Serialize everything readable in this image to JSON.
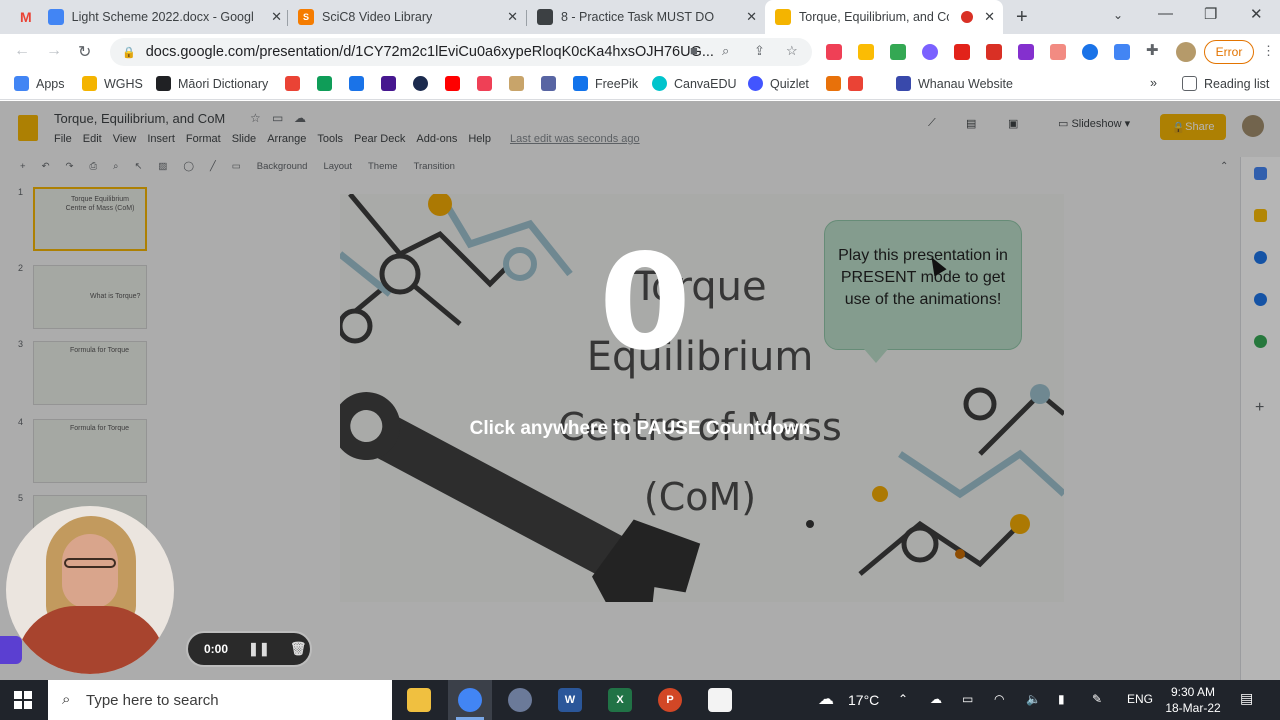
{
  "browser": {
    "tabs": [
      {
        "title": "Light Scheme 2022.docx - Googl",
        "icon": "google-docs-icon",
        "color": "#4285f4"
      },
      {
        "title": "SciC8 Video Library",
        "icon": "video-library-icon",
        "color": "#f57c00"
      },
      {
        "title": "8 - Practice Task MUST DO",
        "icon": "classroom-icon",
        "color": "#3c4043"
      },
      {
        "title": "Torque, Equilibrium, and CoM",
        "icon": "google-slides-icon",
        "color": "#f4b400"
      }
    ],
    "url": "docs.google.com/presentation/d/1CY72m2c1lEviCu0a6xypeRloqK0cKa4hxsOJH76UG...",
    "error_label": "Error",
    "bookmarks": [
      {
        "label": "Apps",
        "color": "#4285f4"
      },
      {
        "label": "WGHS",
        "color": "#f4b400"
      },
      {
        "label": "Māori Dictionary",
        "color": "#202124"
      },
      {
        "label": "",
        "color": "#ea4335"
      },
      {
        "label": "",
        "color": "#0f9d58"
      },
      {
        "label": "",
        "color": "#1a73e8"
      },
      {
        "label": "",
        "color": "#46178f"
      },
      {
        "label": "",
        "color": "#1b2a4e"
      },
      {
        "label": "",
        "color": "#ff0000"
      },
      {
        "label": "",
        "color": "#ef4056"
      },
      {
        "label": "",
        "color": "#c8a46a"
      },
      {
        "label": "",
        "color": "#5865a3"
      },
      {
        "label": "FreePik",
        "color": "#1273eb"
      },
      {
        "label": "CanvaEDU",
        "color": "#00c4cc"
      },
      {
        "label": "Quizlet",
        "color": "#4255ff"
      },
      {
        "label": "",
        "color": "#e8710a"
      },
      {
        "label": "Whanau Website",
        "color": "#3949ab"
      }
    ],
    "reading_list": "Reading list"
  },
  "slides": {
    "doc_title": "Torque, Equilibrium, and CoM",
    "menu": [
      "File",
      "Edit",
      "View",
      "Insert",
      "Format",
      "Slide",
      "Arrange",
      "Tools",
      "Pear Deck",
      "Add-ons",
      "Help"
    ],
    "last_edit": "Last edit was seconds ago",
    "toolbar": [
      "Background",
      "Layout",
      "Theme",
      "Transition"
    ],
    "slideshow_label": "Slideshow",
    "share_label": "Share",
    "thumbnails": [
      {
        "num": "1",
        "text": "Torque Equilibrium Centre of Mass (CoM)"
      },
      {
        "num": "2",
        "text": "What is Torque?"
      },
      {
        "num": "3",
        "text": "Formula for Torque"
      },
      {
        "num": "4",
        "text": "Formula for Torque"
      },
      {
        "num": "5",
        "text": ""
      }
    ],
    "slide": {
      "title_line1": "Torque",
      "title_line2": "Equilibrium",
      "title_line3": "Centre of Mass (CoM)",
      "bubble_text": "Play this presentation in PRESENT mode to get use of the animations!"
    }
  },
  "countdown": {
    "number": "0",
    "message": "Click anywhere to PAUSE Countdown"
  },
  "recorder": {
    "time": "0:00"
  },
  "taskbar": {
    "search_placeholder": "Type here to search",
    "weather": "17°C",
    "language": "ENG",
    "time": "9:30 AM",
    "date": "18-Mar-22",
    "apps": [
      {
        "icon": "file-explorer-icon",
        "color": "#f0c040",
        "label": ""
      },
      {
        "icon": "chrome-icon",
        "color": "#4285f4",
        "label": ""
      },
      {
        "icon": "snip-icon",
        "color": "#6b7a99",
        "label": ""
      },
      {
        "icon": "word-icon",
        "color": "#2b579a",
        "label": "W"
      },
      {
        "icon": "excel-icon",
        "color": "#217346",
        "label": "X"
      },
      {
        "icon": "powerpoint-icon",
        "color": "#d24726",
        "label": "P"
      },
      {
        "icon": "store-icon",
        "color": "#f3f3f3",
        "label": ""
      }
    ]
  }
}
